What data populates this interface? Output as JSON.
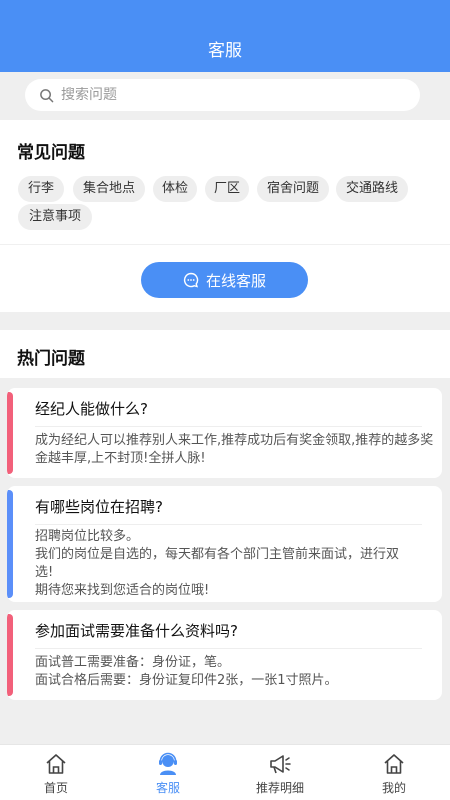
{
  "header": {
    "title": "客服"
  },
  "search": {
    "placeholder": "搜索问题"
  },
  "faq": {
    "title": "常见问题",
    "tags": [
      "行李",
      "集合地点",
      "体检",
      "厂区",
      "宿舍问题",
      "交通路线",
      "注意事项"
    ],
    "online_button": "在线客服"
  },
  "hot": {
    "title": "热门问题",
    "items": [
      {
        "question": "经纪人能做什么?",
        "answer": [
          "成为经纪人可以推荐别人来工作,推荐成功后有奖金领取,推荐的越多奖金越丰厚,上不封顶!全拼人脉!"
        ]
      },
      {
        "question": "有哪些岗位在招聘?",
        "answer": [
          "招聘岗位比较多。",
          "我们的岗位是自选的，每天都有各个部门主管前来面试，进行双选!",
          "期待您来找到您适合的岗位哦!"
        ]
      },
      {
        "question": "参加面试需要准备什么资料吗?",
        "answer": [
          "面试普工需要准备：身份证，笔。",
          "面试合格后需要：身份证复印件2张，一张1寸照片。"
        ]
      }
    ]
  },
  "colors": {
    "accent": "#4a8ff5",
    "pink": "#f2607a",
    "blue_bar": "#5b8ff9"
  },
  "tabbar": {
    "items": [
      {
        "label": "首页",
        "icon": "home-icon"
      },
      {
        "label": "客服",
        "icon": "customer-service-icon"
      },
      {
        "label": "推荐明细",
        "icon": "megaphone-icon"
      },
      {
        "label": "我的",
        "icon": "home-icon"
      }
    ]
  }
}
